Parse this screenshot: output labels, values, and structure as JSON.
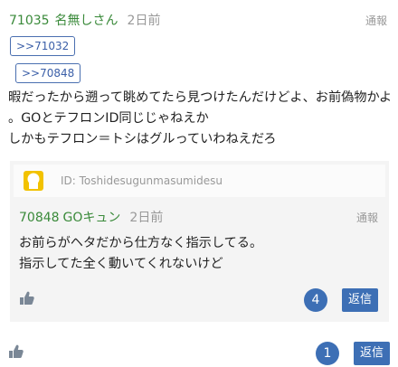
{
  "post": {
    "number": "71035",
    "author": "名無しさん",
    "date": "2日前",
    "report_label": "通報",
    "anchors": [
      ">>71032",
      ">>70848"
    ],
    "body_lines": [
      "暇だったから遡って眺めてたら見つけたんだけどよ、お前偽物かよ",
      "。GOとテフロンID同じじゃねえか",
      "しかもテフロン＝トシはグルっていわねえだろ"
    ],
    "like_count": "1",
    "reply_label": "返信"
  },
  "quoted_reply": {
    "id_label": "ID: Toshidesugunmasumidesu",
    "number": "70848",
    "author": "GOキュン",
    "date": "2日前",
    "report_label": "通報",
    "body_lines": [
      "お前らがヘタだから仕方なく指示してる。",
      "指示してた全く動いてくれないけど"
    ],
    "like_count": "4",
    "reply_label": "返信"
  },
  "colors": {
    "accent_green": "#3a8a3a",
    "button_blue": "#3d6fb5",
    "avatar_yellow": "#f2c200"
  },
  "icons": [
    "thumbs-up-icon",
    "user-avatar-icon"
  ]
}
